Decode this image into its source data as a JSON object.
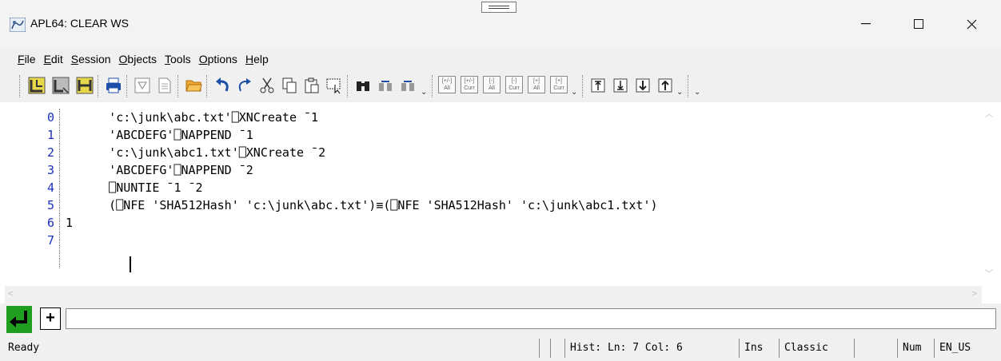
{
  "window": {
    "title": "APL64: CLEAR WS",
    "minimize_glyph": "—",
    "maximize_glyph": "☐",
    "close_glyph": "✕"
  },
  "menu": {
    "items": [
      {
        "label": "File"
      },
      {
        "label": "Edit"
      },
      {
        "label": "Session"
      },
      {
        "label": "Objects"
      },
      {
        "label": "Tools"
      },
      {
        "label": "Options"
      },
      {
        "label": "Help"
      }
    ]
  },
  "toolbar": {
    "icons": [
      "new-session-icon",
      "split-icon",
      "yellow-split-icon",
      "print-icon",
      "filter-icon",
      "document-icon",
      "open-folder-icon",
      "undo-icon",
      "redo-icon",
      "cut-icon",
      "copy-icon",
      "paste-icon",
      "select-icon",
      "find-icon",
      "find-next-icon",
      "find-prev-icon"
    ],
    "small_buttons": [
      {
        "top": "[+/-]",
        "bottom": "All"
      },
      {
        "top": "[+/-]",
        "bottom": "Curr"
      },
      {
        "top": "[-]",
        "bottom": "All"
      },
      {
        "top": "[-]",
        "bottom": "Curr"
      },
      {
        "top": "[+]",
        "bottom": "All"
      },
      {
        "top": "[+]",
        "bottom": "Curr"
      }
    ]
  },
  "session": {
    "line_numbers": [
      "0",
      "1",
      "2",
      "3",
      "4",
      "5",
      "6",
      "7"
    ],
    "lines": [
      "      'c:\\junk\\abc.txt'⎕XNCreate ¯1",
      "      'ABCDEFG'⎕NAPPEND ¯1",
      "      'c:\\junk\\abc1.txt'⎕XNCreate ¯2",
      "      'ABCDEFG'⎕NAPPEND ¯2",
      "      ⎕NUNTIE ¯1 ¯2",
      "      (⎕NFE 'SHA512Hash' 'c:\\junk\\abc.txt')≡(⎕NFE 'SHA512Hash' 'c:\\junk\\abc1.txt')",
      "1",
      "      "
    ]
  },
  "input": {
    "plus_label": "+",
    "value": ""
  },
  "status": {
    "ready": "Ready",
    "hist": "Hist: Ln: 7 Col: 6",
    "mode": "Ins",
    "style": "Classic",
    "num": "Num",
    "locale": "EN_US"
  },
  "colors": {
    "line_number": "#1a2fbf",
    "exec_button": "#1f9e1f"
  }
}
